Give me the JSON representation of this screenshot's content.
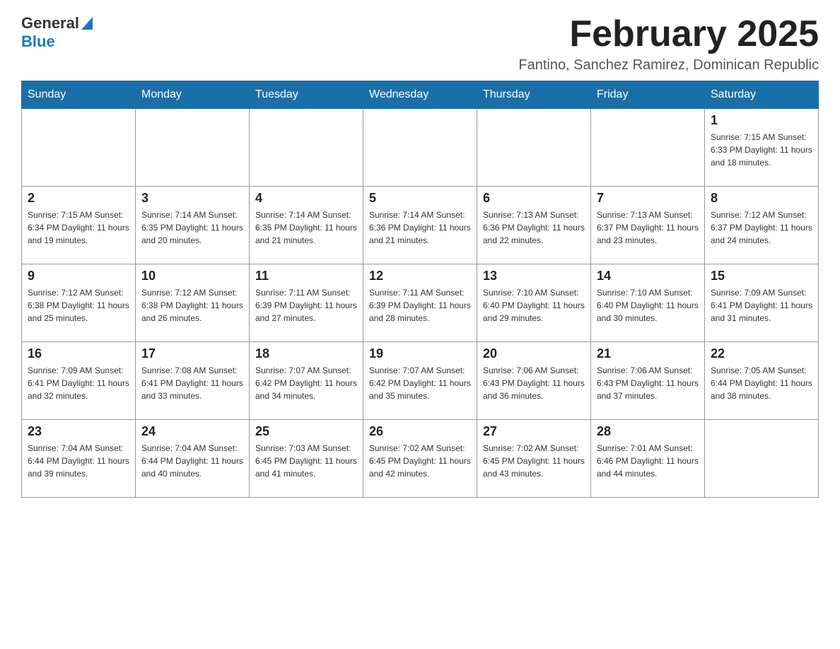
{
  "logo": {
    "general": "General",
    "blue": "Blue"
  },
  "title": "February 2025",
  "subtitle": "Fantino, Sanchez Ramirez, Dominican Republic",
  "weekdays": [
    "Sunday",
    "Monday",
    "Tuesday",
    "Wednesday",
    "Thursday",
    "Friday",
    "Saturday"
  ],
  "weeks": [
    [
      {
        "day": "",
        "info": ""
      },
      {
        "day": "",
        "info": ""
      },
      {
        "day": "",
        "info": ""
      },
      {
        "day": "",
        "info": ""
      },
      {
        "day": "",
        "info": ""
      },
      {
        "day": "",
        "info": ""
      },
      {
        "day": "1",
        "info": "Sunrise: 7:15 AM\nSunset: 6:33 PM\nDaylight: 11 hours\nand 18 minutes."
      }
    ],
    [
      {
        "day": "2",
        "info": "Sunrise: 7:15 AM\nSunset: 6:34 PM\nDaylight: 11 hours\nand 19 minutes."
      },
      {
        "day": "3",
        "info": "Sunrise: 7:14 AM\nSunset: 6:35 PM\nDaylight: 11 hours\nand 20 minutes."
      },
      {
        "day": "4",
        "info": "Sunrise: 7:14 AM\nSunset: 6:35 PM\nDaylight: 11 hours\nand 21 minutes."
      },
      {
        "day": "5",
        "info": "Sunrise: 7:14 AM\nSunset: 6:36 PM\nDaylight: 11 hours\nand 21 minutes."
      },
      {
        "day": "6",
        "info": "Sunrise: 7:13 AM\nSunset: 6:36 PM\nDaylight: 11 hours\nand 22 minutes."
      },
      {
        "day": "7",
        "info": "Sunrise: 7:13 AM\nSunset: 6:37 PM\nDaylight: 11 hours\nand 23 minutes."
      },
      {
        "day": "8",
        "info": "Sunrise: 7:12 AM\nSunset: 6:37 PM\nDaylight: 11 hours\nand 24 minutes."
      }
    ],
    [
      {
        "day": "9",
        "info": "Sunrise: 7:12 AM\nSunset: 6:38 PM\nDaylight: 11 hours\nand 25 minutes."
      },
      {
        "day": "10",
        "info": "Sunrise: 7:12 AM\nSunset: 6:38 PM\nDaylight: 11 hours\nand 26 minutes."
      },
      {
        "day": "11",
        "info": "Sunrise: 7:11 AM\nSunset: 6:39 PM\nDaylight: 11 hours\nand 27 minutes."
      },
      {
        "day": "12",
        "info": "Sunrise: 7:11 AM\nSunset: 6:39 PM\nDaylight: 11 hours\nand 28 minutes."
      },
      {
        "day": "13",
        "info": "Sunrise: 7:10 AM\nSunset: 6:40 PM\nDaylight: 11 hours\nand 29 minutes."
      },
      {
        "day": "14",
        "info": "Sunrise: 7:10 AM\nSunset: 6:40 PM\nDaylight: 11 hours\nand 30 minutes."
      },
      {
        "day": "15",
        "info": "Sunrise: 7:09 AM\nSunset: 6:41 PM\nDaylight: 11 hours\nand 31 minutes."
      }
    ],
    [
      {
        "day": "16",
        "info": "Sunrise: 7:09 AM\nSunset: 6:41 PM\nDaylight: 11 hours\nand 32 minutes."
      },
      {
        "day": "17",
        "info": "Sunrise: 7:08 AM\nSunset: 6:41 PM\nDaylight: 11 hours\nand 33 minutes."
      },
      {
        "day": "18",
        "info": "Sunrise: 7:07 AM\nSunset: 6:42 PM\nDaylight: 11 hours\nand 34 minutes."
      },
      {
        "day": "19",
        "info": "Sunrise: 7:07 AM\nSunset: 6:42 PM\nDaylight: 11 hours\nand 35 minutes."
      },
      {
        "day": "20",
        "info": "Sunrise: 7:06 AM\nSunset: 6:43 PM\nDaylight: 11 hours\nand 36 minutes."
      },
      {
        "day": "21",
        "info": "Sunrise: 7:06 AM\nSunset: 6:43 PM\nDaylight: 11 hours\nand 37 minutes."
      },
      {
        "day": "22",
        "info": "Sunrise: 7:05 AM\nSunset: 6:44 PM\nDaylight: 11 hours\nand 38 minutes."
      }
    ],
    [
      {
        "day": "23",
        "info": "Sunrise: 7:04 AM\nSunset: 6:44 PM\nDaylight: 11 hours\nand 39 minutes."
      },
      {
        "day": "24",
        "info": "Sunrise: 7:04 AM\nSunset: 6:44 PM\nDaylight: 11 hours\nand 40 minutes."
      },
      {
        "day": "25",
        "info": "Sunrise: 7:03 AM\nSunset: 6:45 PM\nDaylight: 11 hours\nand 41 minutes."
      },
      {
        "day": "26",
        "info": "Sunrise: 7:02 AM\nSunset: 6:45 PM\nDaylight: 11 hours\nand 42 minutes."
      },
      {
        "day": "27",
        "info": "Sunrise: 7:02 AM\nSunset: 6:45 PM\nDaylight: 11 hours\nand 43 minutes."
      },
      {
        "day": "28",
        "info": "Sunrise: 7:01 AM\nSunset: 6:46 PM\nDaylight: 11 hours\nand 44 minutes."
      },
      {
        "day": "",
        "info": ""
      }
    ]
  ]
}
